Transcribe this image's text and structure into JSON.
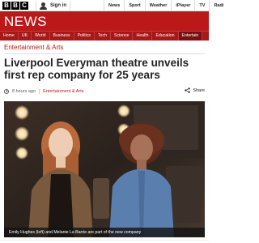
{
  "topbar": {
    "logo": [
      "B",
      "B",
      "C"
    ],
    "signin_label": "Sign in",
    "nav": [
      "News",
      "Sport",
      "Weather",
      "iPlayer",
      "TV",
      "Radi"
    ]
  },
  "header": {
    "title": "NEWS"
  },
  "section_nav": {
    "items": [
      "Home",
      "UK",
      "World",
      "Business",
      "Politics",
      "Tech",
      "Science",
      "Health",
      "Education",
      "Entertain"
    ],
    "active": "Entertain"
  },
  "breadcrumb": "Entertainment & Arts",
  "article": {
    "headline": "Liverpool Everyman theatre unveils first rep company for 25 years",
    "timestamp": "8 hours ago",
    "section": "Entertainment & Arts",
    "share_label": "Share",
    "caption": "Emily Hughes (left) and Melanie La Barrie are part of the new company"
  },
  "colors": {
    "brand_red": "#bb1919",
    "nav_red": "#a91717"
  }
}
